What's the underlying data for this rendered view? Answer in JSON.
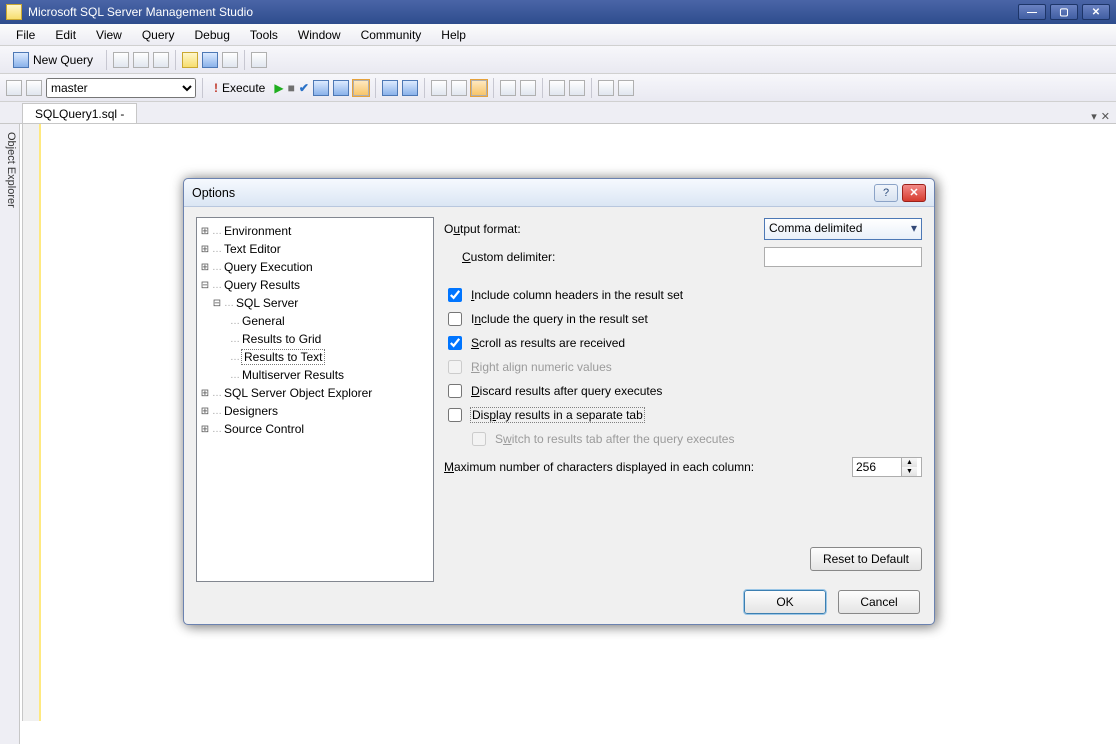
{
  "window": {
    "title": "Microsoft SQL Server Management Studio"
  },
  "menu": {
    "items": [
      "File",
      "Edit",
      "View",
      "Query",
      "Debug",
      "Tools",
      "Window",
      "Community",
      "Help"
    ]
  },
  "toolbar1": {
    "newQuery": "New Query"
  },
  "toolbar2": {
    "database": "master",
    "execute": "Execute"
  },
  "sideTab": "Object Explorer",
  "fileTab": "SQLQuery1.sql -",
  "dialog": {
    "title": "Options",
    "tree": {
      "env": "Environment",
      "textEditor": "Text Editor",
      "queryExec": "Query Execution",
      "queryResults": "Query Results",
      "sqlServer": "SQL Server",
      "general": "General",
      "resultsGrid": "Results to Grid",
      "resultsText": "Results to Text",
      "multiserver": "Multiserver Results",
      "objExplorer": "SQL Server Object Explorer",
      "designers": "Designers",
      "sourceControl": "Source Control"
    },
    "panel": {
      "outputFormatLabel_pre": "O",
      "outputFormatLabel_u": "u",
      "outputFormatLabel_post": "tput format:",
      "outputFormatValue": "Comma delimited",
      "customDelimiterLabel_u": "C",
      "customDelimiterLabel_post": "ustom delimiter:",
      "customDelimiterValue": "",
      "includeHeaders_u": "I",
      "includeHeaders_post": "nclude column headers in the result set",
      "includeQuery_pre": "I",
      "includeQuery_u": "n",
      "includeQuery_post": "clude the query in the result set",
      "scroll_u": "S",
      "scroll_post": "croll as results are received",
      "rightAlign_u": "R",
      "rightAlign_post": "ight align numeric values",
      "discard_u": "D",
      "discard_post": "iscard results after query executes",
      "displaySep_pre": "Dis",
      "displaySep_u": "p",
      "displaySep_post": "lay results in a separate tab",
      "switchTab_pre": "S",
      "switchTab_u": "w",
      "switchTab_post": "itch to results tab after the query executes",
      "maxChars_u": "M",
      "maxChars_post": "aximum number of characters displayed in each column:",
      "maxCharsValue": "256"
    },
    "buttons": {
      "reset": "Reset to Default",
      "ok": "OK",
      "cancel": "Cancel"
    }
  }
}
